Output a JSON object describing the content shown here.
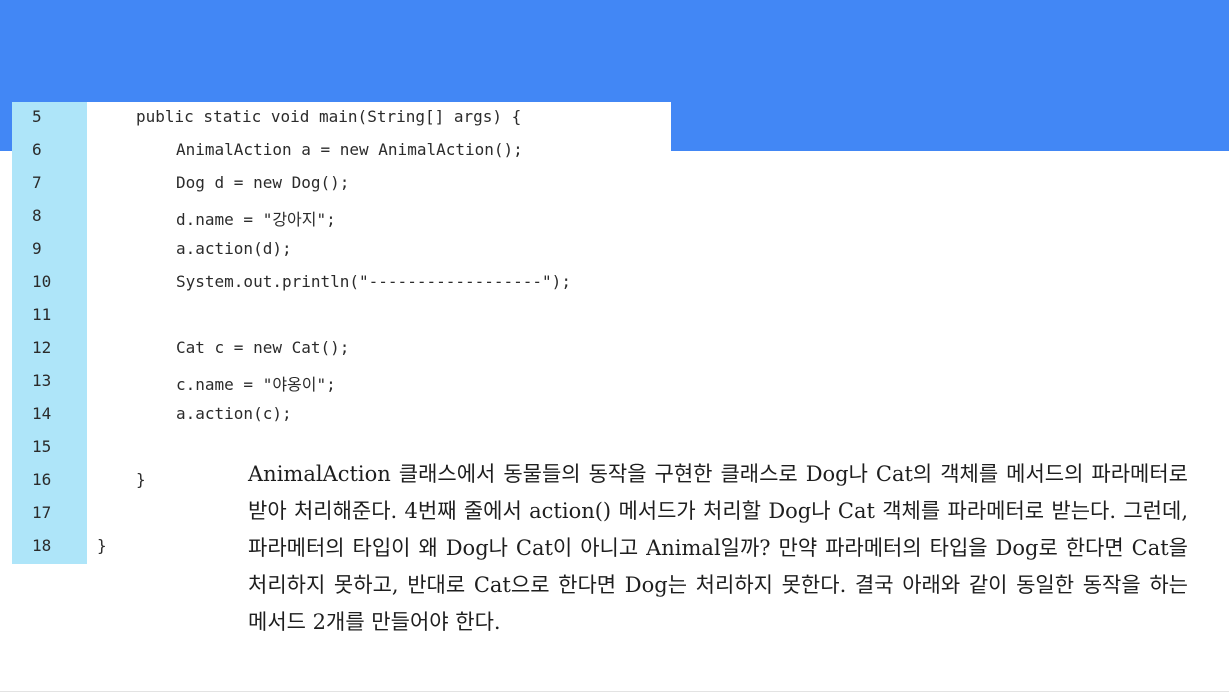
{
  "code": {
    "lines": [
      {
        "no": "5",
        "text": "public static void main(String[] args) {",
        "indent": 1
      },
      {
        "no": "6",
        "text": "AnimalAction a = new AnimalAction();",
        "indent": 2
      },
      {
        "no": "7",
        "text": "Dog d = new Dog();",
        "indent": 2
      },
      {
        "no": "8",
        "text": "d.name = \"강아지\";",
        "indent": 2
      },
      {
        "no": "9",
        "text": "a.action(d);",
        "indent": 2
      },
      {
        "no": "10",
        "text": "System.out.println(\"------------------\");",
        "indent": 2
      },
      {
        "no": "11",
        "text": "",
        "indent": 2
      },
      {
        "no": "12",
        "text": "Cat c = new Cat();",
        "indent": 2
      },
      {
        "no": "13",
        "text": "c.name = \"야옹이\";",
        "indent": 2
      },
      {
        "no": "14",
        "text": "a.action(c);",
        "indent": 2
      },
      {
        "no": "15",
        "text": "",
        "indent": 2
      },
      {
        "no": "16",
        "text": "}",
        "indent": 1
      },
      {
        "no": "17",
        "text": "",
        "indent": 1
      },
      {
        "no": "18",
        "text": "}",
        "indent": 0
      }
    ]
  },
  "explanation": {
    "text": "AnimalAction 클래스에서 동물들의 동작을 구현한 클래스로 Dog나 Cat의 객체를 메서드의 파라메터로 받아 처리해준다. 4번째 줄에서 action() 메서드가 처리할 Dog나 Cat 객체를 파라메터로 받는다. 그런데, 파라메터의 타입이 왜 Dog나 Cat이 아니고 Animal일까? 만약 파라메터의 타입을 Dog로 한다면 Cat을 처리하지 못하고, 반대로 Cat으로 한다면 Dog는 처리하지 못한다. 결국 아래와 같이 동일한 동작을 하는 메서드 2개를 만들어야 한다."
  },
  "colors": {
    "band": "#4287f5",
    "gutter": "#aee5f9"
  }
}
